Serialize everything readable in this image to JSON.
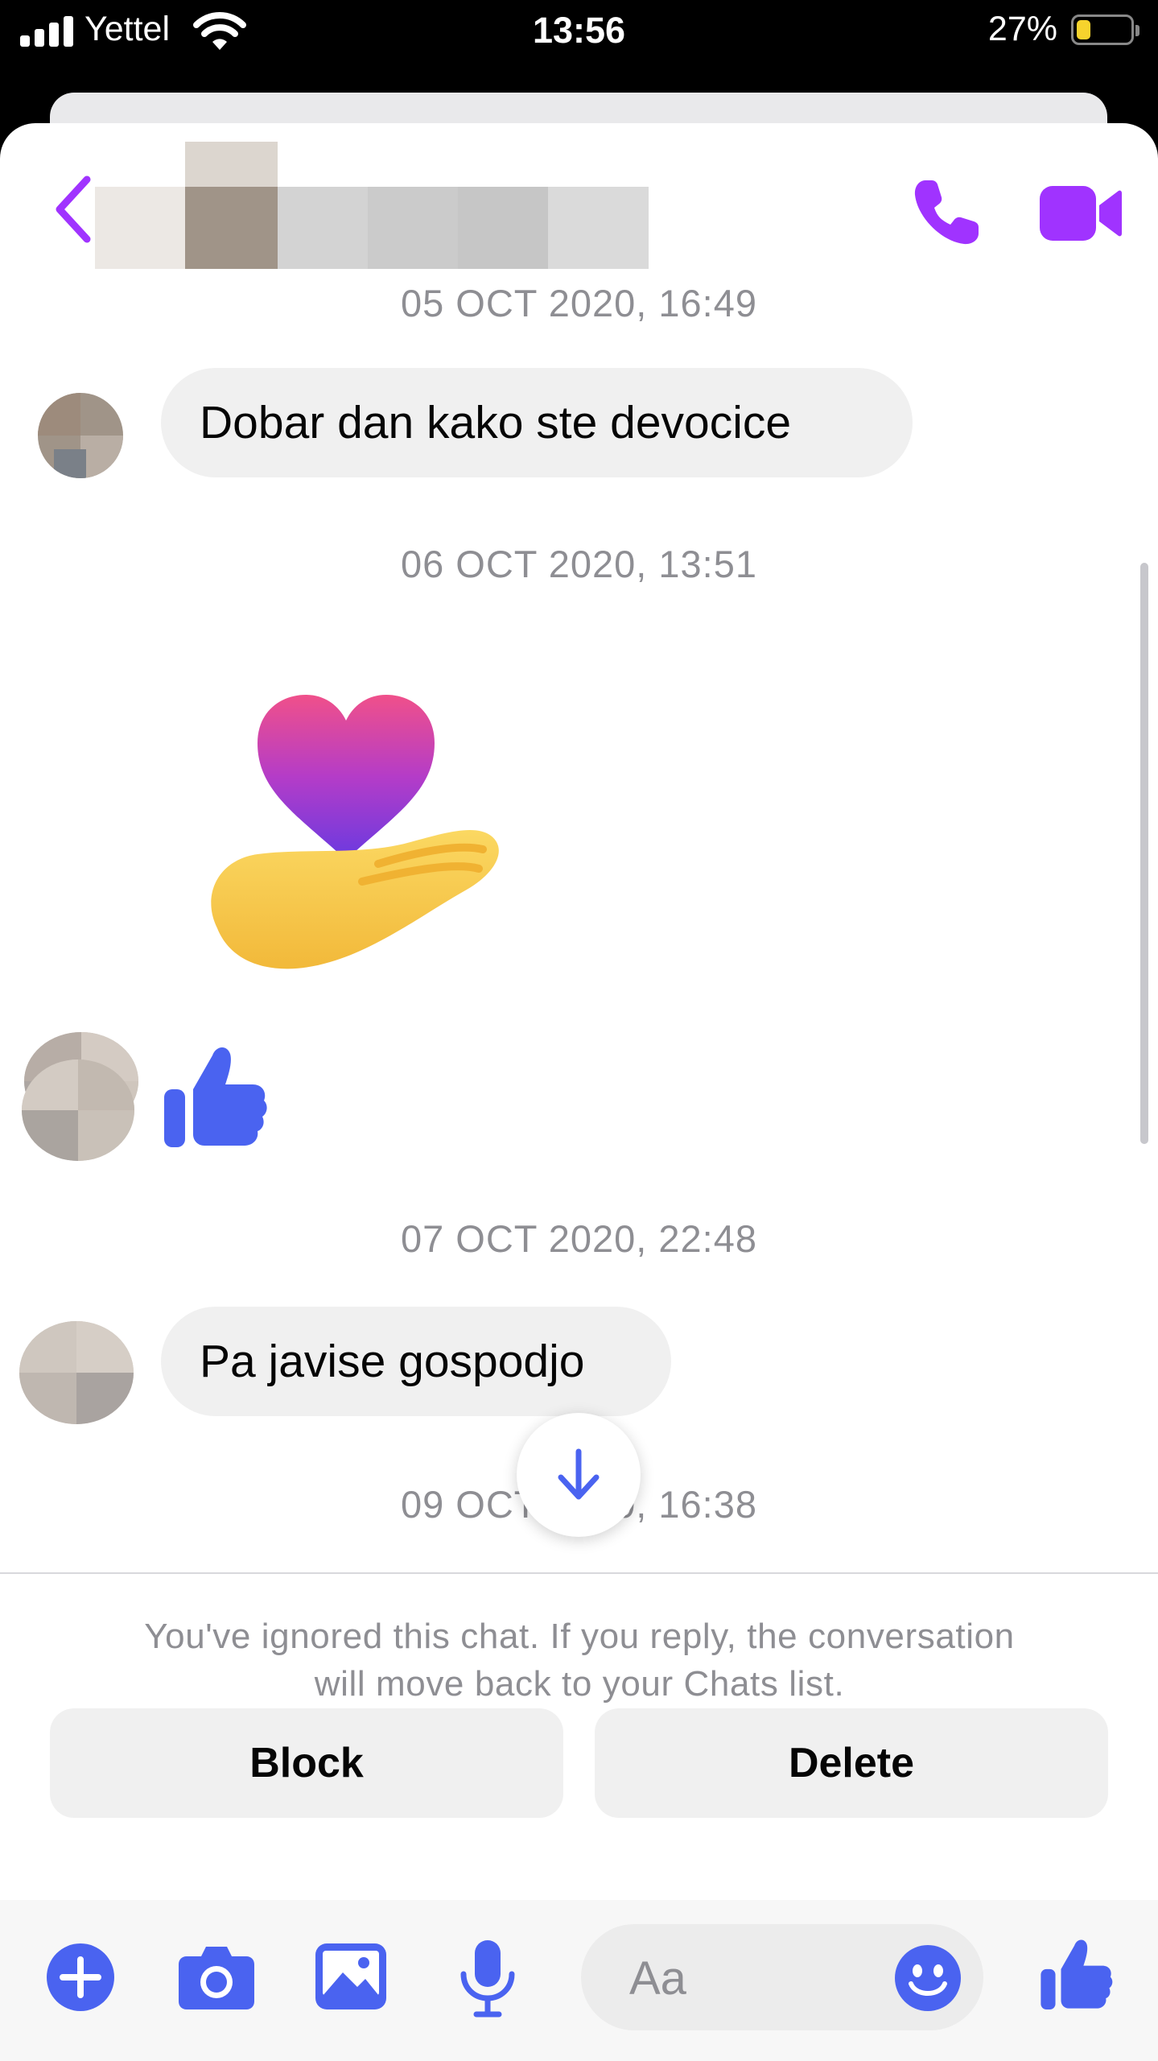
{
  "status_bar": {
    "carrier": "Yettel",
    "time": "13:56",
    "battery_percent": "27%",
    "battery_level": 0.27,
    "battery_color": "#f6d32d"
  },
  "header": {
    "back_icon": "chevron-left-icon",
    "call_icon": "phone-icon",
    "video_icon": "video-camera-icon",
    "accent_color": "#a033ff"
  },
  "messages": [
    {
      "type": "date",
      "text": "05 OCT 2020, 16:49"
    },
    {
      "type": "text",
      "text": "Dobar dan kako ste devocice"
    },
    {
      "type": "date",
      "text": "06 OCT 2020, 13:51"
    },
    {
      "type": "sticker",
      "icon": "heart-in-hand-sticker"
    },
    {
      "type": "sticker",
      "icon": "thumbs-up-icon"
    },
    {
      "type": "date",
      "text": "07 OCT 2020, 22:48"
    },
    {
      "type": "text",
      "text": "Pa javise gospodjo"
    },
    {
      "type": "date",
      "text": "09 OCT 2020, 16:38"
    }
  ],
  "scroll_button_icon": "arrow-down-icon",
  "ignored_notice": {
    "line1": "You've ignored this chat. If you reply, the conversation",
    "line2": "will move back to your Chats list.",
    "block_label": "Block",
    "delete_label": "Delete"
  },
  "composer": {
    "placeholder": "Aa",
    "icons": [
      "plus-icon",
      "camera-icon",
      "image-icon",
      "microphone-icon",
      "emoji-icon",
      "thumbs-up-icon"
    ],
    "icon_color": "#4a63f0"
  }
}
